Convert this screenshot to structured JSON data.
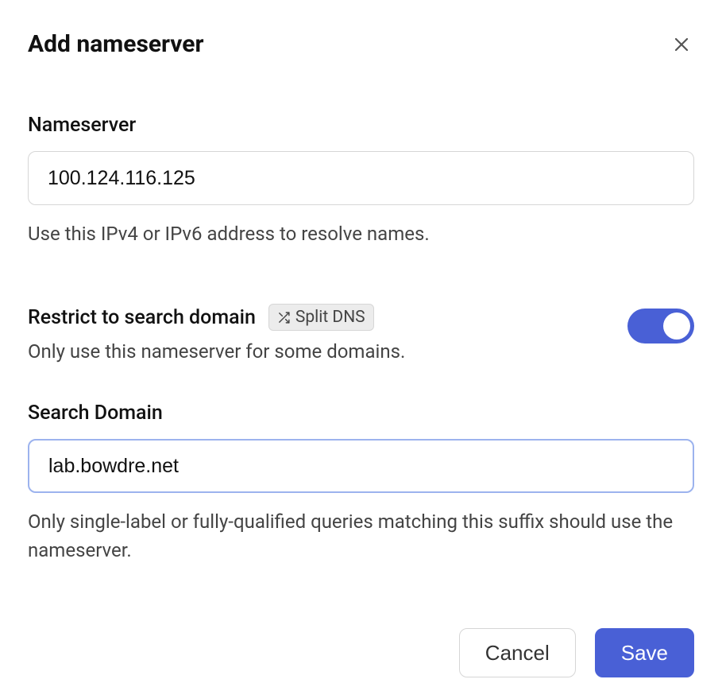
{
  "dialog": {
    "title": "Add nameserver"
  },
  "nameserver": {
    "label": "Nameserver",
    "value": "100.124.116.125",
    "help": "Use this IPv4 or IPv6 address to resolve names."
  },
  "restrict": {
    "heading": "Restrict to search domain",
    "badge_label": "Split DNS",
    "description": "Only use this nameserver for some domains.",
    "enabled": true
  },
  "search_domain": {
    "label": "Search Domain",
    "value": "lab.bowdre.net",
    "help": "Only single-label or fully-qualified queries matching this suffix should use the nameserver."
  },
  "buttons": {
    "cancel": "Cancel",
    "save": "Save"
  }
}
